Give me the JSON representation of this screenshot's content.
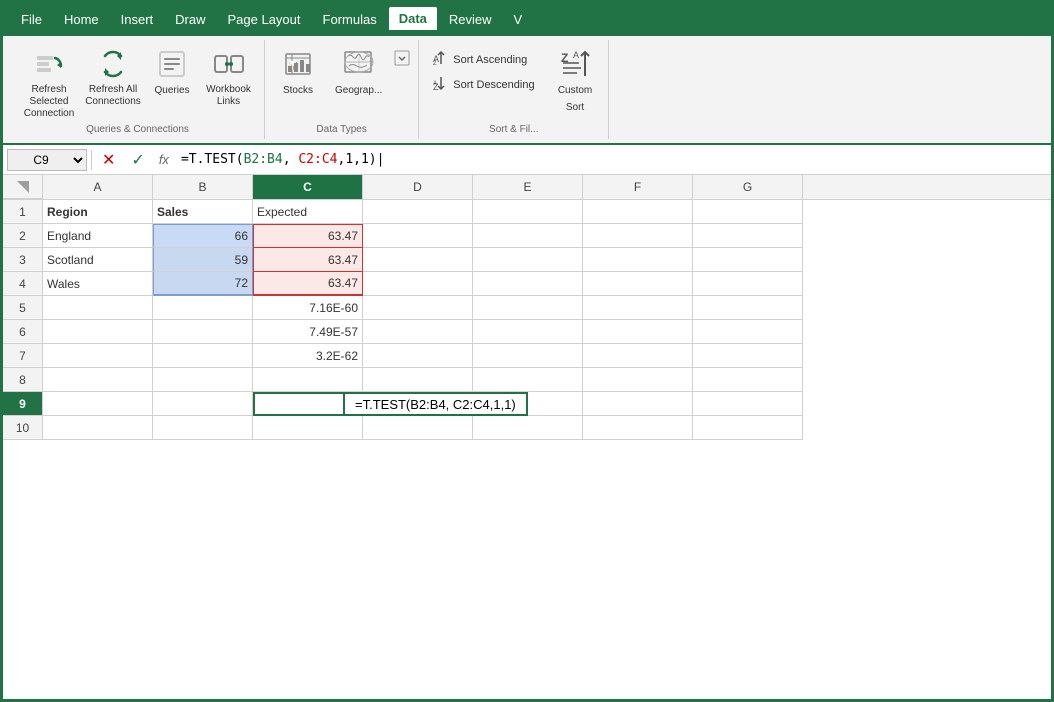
{
  "menu": {
    "items": [
      "File",
      "Home",
      "Insert",
      "Draw",
      "Page Layout",
      "Formulas",
      "Data",
      "Review",
      "V"
    ],
    "active": "Data"
  },
  "ribbon": {
    "groups": {
      "queries_connections": {
        "label": "Queries & Connections",
        "buttons": [
          {
            "id": "refresh-selected",
            "label": "Refresh Selected\nConnection",
            "icon": "🔄"
          },
          {
            "id": "refresh-all",
            "label": "Refresh All\nConnections",
            "icon": "🔄"
          },
          {
            "id": "queries",
            "label": "Queries",
            "icon": "📋"
          },
          {
            "id": "workbook-links",
            "label": "Workbook\nLinks",
            "icon": "🔗"
          }
        ]
      },
      "data_types": {
        "label": "Data Types",
        "buttons": [
          {
            "id": "stocks",
            "label": "Stocks",
            "icon": "🏛"
          },
          {
            "id": "geography",
            "label": "Geograp...",
            "icon": "🗺"
          }
        ]
      },
      "sort_filter": {
        "label": "Sort & Fil...",
        "sort_asc": "Sort Ascending",
        "sort_desc": "Sort Descending",
        "custom_label": "Custom",
        "sort_label": "Sort"
      }
    }
  },
  "formula_bar": {
    "cell_ref": "C9",
    "formula": "=T.TEST(B2:B4, C2:C4,1,1)",
    "formula_display": "=T.TEST(B2:B4, C2:C4,1,1)",
    "formula_b_part": "B2:B4",
    "formula_c_part": "C2:C4"
  },
  "columns": {
    "headers": [
      "A",
      "B",
      "C",
      "D",
      "E",
      "F",
      "G"
    ]
  },
  "rows": [
    {
      "num": 1,
      "cells": [
        {
          "v": "Region",
          "bold": true
        },
        {
          "v": "Sales",
          "bold": true
        },
        {
          "v": "Expected",
          "bold": false
        },
        {
          "v": ""
        },
        {
          "v": ""
        },
        {
          "v": ""
        },
        {
          "v": ""
        }
      ]
    },
    {
      "num": 2,
      "cells": [
        {
          "v": "England"
        },
        {
          "v": "66",
          "align": "right",
          "inRangeB": true
        },
        {
          "v": "63.47",
          "align": "right",
          "inRangeC": true
        },
        {
          "v": ""
        },
        {
          "v": ""
        },
        {
          "v": ""
        },
        {
          "v": ""
        }
      ]
    },
    {
      "num": 3,
      "cells": [
        {
          "v": "Scotland"
        },
        {
          "v": "59",
          "align": "right",
          "inRangeB": true
        },
        {
          "v": "63.47",
          "align": "right",
          "inRangeC": true
        },
        {
          "v": ""
        },
        {
          "v": ""
        },
        {
          "v": ""
        },
        {
          "v": ""
        }
      ]
    },
    {
      "num": 4,
      "cells": [
        {
          "v": "Wales"
        },
        {
          "v": "72",
          "align": "right",
          "inRangeB": true
        },
        {
          "v": "63.47",
          "align": "right",
          "inRangeC": true
        },
        {
          "v": ""
        },
        {
          "v": ""
        },
        {
          "v": ""
        },
        {
          "v": ""
        }
      ]
    },
    {
      "num": 5,
      "cells": [
        {
          "v": ""
        },
        {
          "v": ""
        },
        {
          "v": "7.16E-60",
          "align": "right"
        },
        {
          "v": ""
        },
        {
          "v": ""
        },
        {
          "v": ""
        },
        {
          "v": ""
        }
      ]
    },
    {
      "num": 6,
      "cells": [
        {
          "v": ""
        },
        {
          "v": ""
        },
        {
          "v": "7.49E-57",
          "align": "right"
        },
        {
          "v": ""
        },
        {
          "v": ""
        },
        {
          "v": ""
        },
        {
          "v": ""
        }
      ]
    },
    {
      "num": 7,
      "cells": [
        {
          "v": ""
        },
        {
          "v": ""
        },
        {
          "v": "3.2E-62",
          "align": "right"
        },
        {
          "v": ""
        },
        {
          "v": ""
        },
        {
          "v": ""
        },
        {
          "v": ""
        }
      ]
    },
    {
      "num": 8,
      "cells": [
        {
          "v": ""
        },
        {
          "v": ""
        },
        {
          "v": ""
        },
        {
          "v": ""
        },
        {
          "v": ""
        },
        {
          "v": ""
        },
        {
          "v": ""
        }
      ]
    },
    {
      "num": 9,
      "cells": [
        {
          "v": ""
        },
        {
          "v": ""
        },
        {
          "v": "",
          "active": true
        },
        {
          "v": ""
        },
        {
          "v": ""
        },
        {
          "v": ""
        },
        {
          "v": ""
        }
      ],
      "formulaTooltip": "=T.TEST(B2:B4, C2:C4,1,1)"
    },
    {
      "num": 10,
      "cells": [
        {
          "v": ""
        },
        {
          "v": ""
        },
        {
          "v": ""
        },
        {
          "v": ""
        },
        {
          "v": ""
        },
        {
          "v": ""
        },
        {
          "v": ""
        }
      ]
    }
  ],
  "border_color": "#217346",
  "selection_color": "#1f7244"
}
